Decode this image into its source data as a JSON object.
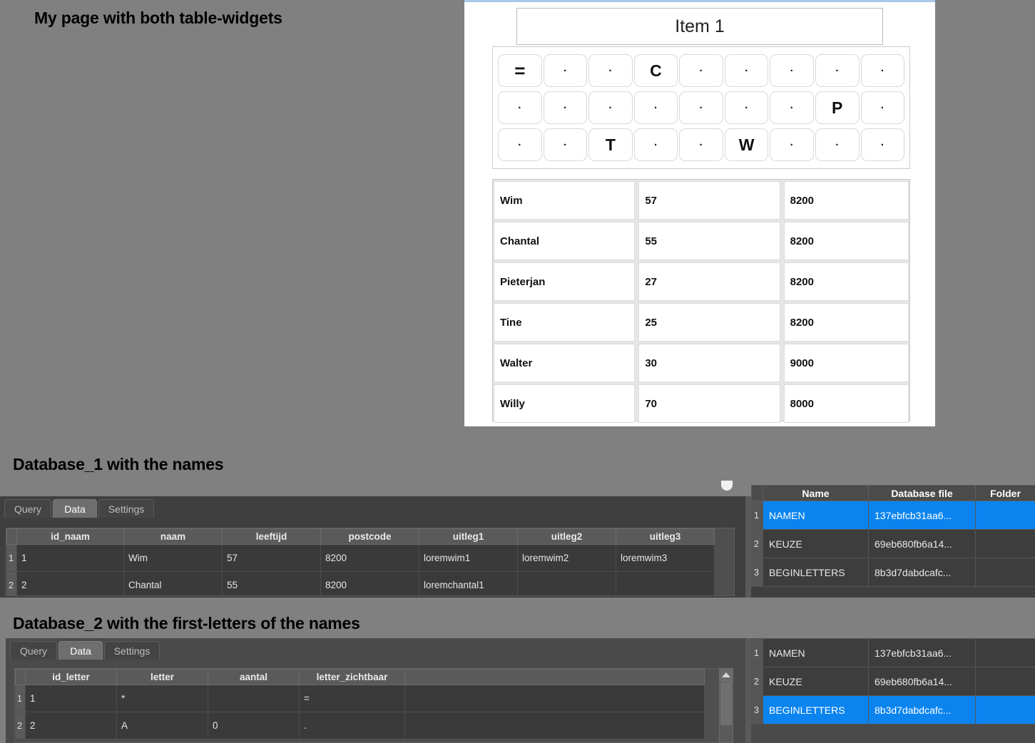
{
  "captions": {
    "main": "My page with both table-widgets",
    "db1": "Database_1 with the names",
    "db2": "Database_2 with the first-letters of the names"
  },
  "widget": {
    "item_title": "Item 1",
    "letter_grid": {
      "rows": [
        [
          "=",
          ".",
          ".",
          "C",
          ".",
          ".",
          ".",
          ".",
          "."
        ],
        [
          ".",
          ".",
          ".",
          ".",
          ".",
          ".",
          ".",
          "P",
          "."
        ],
        [
          ".",
          ".",
          "T",
          ".",
          ".",
          "W",
          ".",
          ".",
          "."
        ]
      ]
    },
    "table": {
      "rows": [
        {
          "naam": "Wim",
          "leeftijd": "57",
          "postcode": "8200"
        },
        {
          "naam": "Chantal",
          "leeftijd": "55",
          "postcode": "8200"
        },
        {
          "naam": "Pieterjan",
          "leeftijd": "27",
          "postcode": "8200"
        },
        {
          "naam": "Tine",
          "leeftijd": "25",
          "postcode": "8200"
        },
        {
          "naam": "Walter",
          "leeftijd": "30",
          "postcode": "9000"
        },
        {
          "naam": "Willy",
          "leeftijd": "70",
          "postcode": "8000"
        }
      ]
    }
  },
  "db1": {
    "tabs": [
      {
        "label": "Query",
        "active": false
      },
      {
        "label": "Data",
        "active": true
      },
      {
        "label": "Settings",
        "active": false
      }
    ],
    "grid": {
      "headers": [
        "id_naam",
        "naam",
        "leeftijd",
        "postcode",
        "uitleg1",
        "uitleg2",
        "uitleg3"
      ],
      "rows": [
        {
          "n": "1",
          "cells": [
            "1",
            "Wim",
            "57",
            "8200",
            "loremwim1",
            "loremwim2",
            "loremwim3"
          ]
        },
        {
          "n": "2",
          "cells": [
            "2",
            "Chantal",
            "55",
            "8200",
            "loremchantal1",
            "",
            ""
          ]
        }
      ]
    },
    "list": {
      "headers": [
        "Name",
        "Database file",
        "Folder"
      ],
      "rows": [
        {
          "n": "1",
          "name": "NAMEN",
          "file": "137ebfcb31aa6...",
          "folder": "",
          "selected": true
        },
        {
          "n": "2",
          "name": "KEUZE",
          "file": "69eb680fb6a14...",
          "folder": "",
          "selected": false
        },
        {
          "n": "3",
          "name": "BEGINLETTERS",
          "file": "8b3d7dabdcafc...",
          "folder": "",
          "selected": false
        }
      ]
    }
  },
  "db2": {
    "tabs": [
      {
        "label": "Query",
        "active": false
      },
      {
        "label": "Data",
        "active": true
      },
      {
        "label": "Settings",
        "active": false
      }
    ],
    "grid": {
      "headers": [
        "id_letter",
        "letter",
        "aantal",
        "letter_zichtbaar",
        ""
      ],
      "rows": [
        {
          "n": "1",
          "cells": [
            "1",
            "*",
            "",
            "=",
            ""
          ]
        },
        {
          "n": "2",
          "cells": [
            "2",
            "A",
            "0",
            ".",
            ""
          ]
        }
      ]
    },
    "list": {
      "headers": [
        "Name",
        "Database file",
        "Folder"
      ],
      "rows": [
        {
          "n": "1",
          "name": "NAMEN",
          "file": "137ebfcb31aa6...",
          "folder": "",
          "selected": false
        },
        {
          "n": "2",
          "name": "KEUZE",
          "file": "69eb680fb6a14...",
          "folder": "",
          "selected": false
        },
        {
          "n": "3",
          "name": "BEGINLETTERS",
          "file": "8b3d7dabdcafc...",
          "folder": "",
          "selected": true
        }
      ]
    }
  },
  "colors": {
    "page_background": "#808080",
    "selection_blue": "#0b84ef",
    "panel_white": "#ffffff",
    "panel_dark": "#3f3f3f"
  }
}
